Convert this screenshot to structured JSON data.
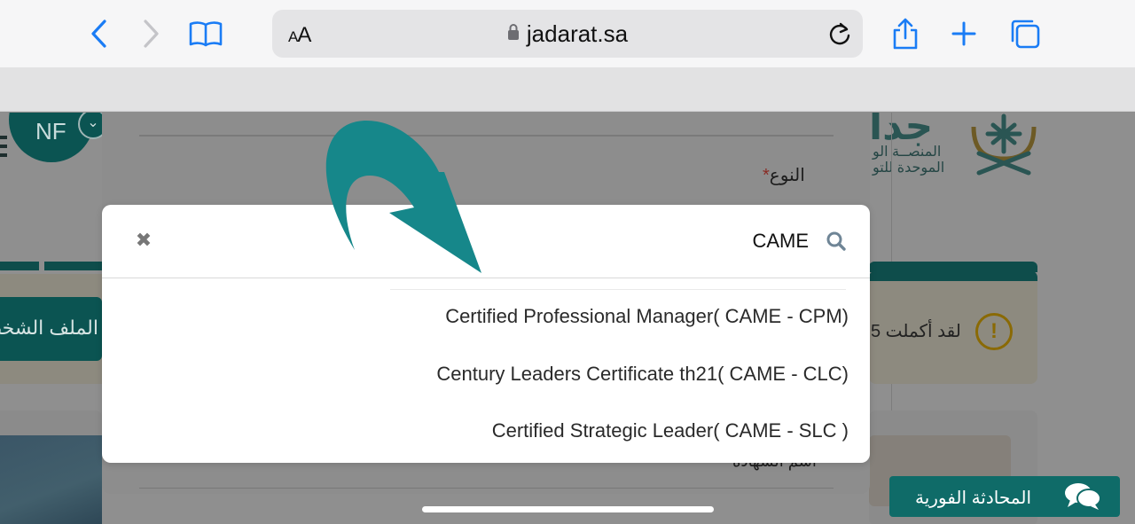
{
  "browser": {
    "url": "jadarat.sa",
    "text_size_label_small": "A",
    "text_size_label_large": "A"
  },
  "header": {
    "avatar_initials": "NF",
    "chevron": "⌄",
    "logo_big": "جدا",
    "logo_line1": "المنصــة الو",
    "logo_line2": "الموحدة للتو"
  },
  "page": {
    "warning_text": "لقد أكملت 5",
    "warning_icon": "!",
    "profile_button": "الملف الشخصي"
  },
  "modal": {
    "type_label": "النوع",
    "required_mark": "*",
    "cert_name_label": "اسم الشهادة"
  },
  "dropdown": {
    "search_value": "CAME",
    "clear_symbol": "✖",
    "options": [
      "Certified Professional Manager( CAME - CPM)",
      "Century Leaders Certificate th21( CAME - CLC)",
      "Certified Strategic Leader( CAME - SLC )"
    ]
  },
  "chat": {
    "label": "المحادثة الفورية"
  },
  "colors": {
    "accent_teal": "#0f6b68",
    "ios_blue": "#1a7cf5",
    "arrow_teal": "#16878a"
  },
  "icons": {
    "back": "chevron-left-icon",
    "forward": "chevron-right-icon",
    "bookmarks": "book-icon",
    "lock": "lock-icon",
    "reload": "reload-icon",
    "share": "share-icon",
    "new_tab": "plus-icon",
    "tabs": "tabs-icon",
    "search": "search-icon",
    "chat": "chat-bubbles-icon"
  }
}
